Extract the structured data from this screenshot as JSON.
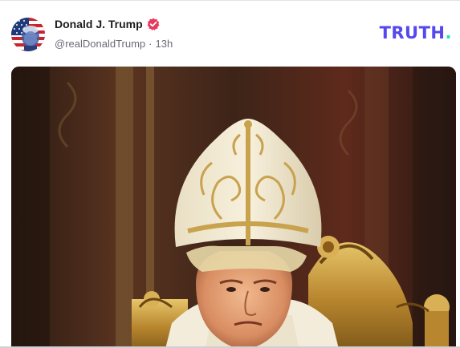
{
  "post": {
    "author": {
      "display_name": "Donald J. Trump",
      "handle": "@realDonaldTrump",
      "verified_icon": "verified-badge-icon"
    },
    "separator": "·",
    "timestamp": "13h",
    "media": {
      "type": "image",
      "subject": "man in white and gold papal mitre seated before gilded throne"
    }
  },
  "brand": {
    "logo_text": "TRUTH",
    "logo_dot": ".",
    "logo_color": "#5448ee",
    "dot_color": "#17e6b4"
  },
  "colors": {
    "verified_badge": "#e5395d",
    "name_text": "#1c1c1e",
    "meta_text": "#6b6b76"
  }
}
